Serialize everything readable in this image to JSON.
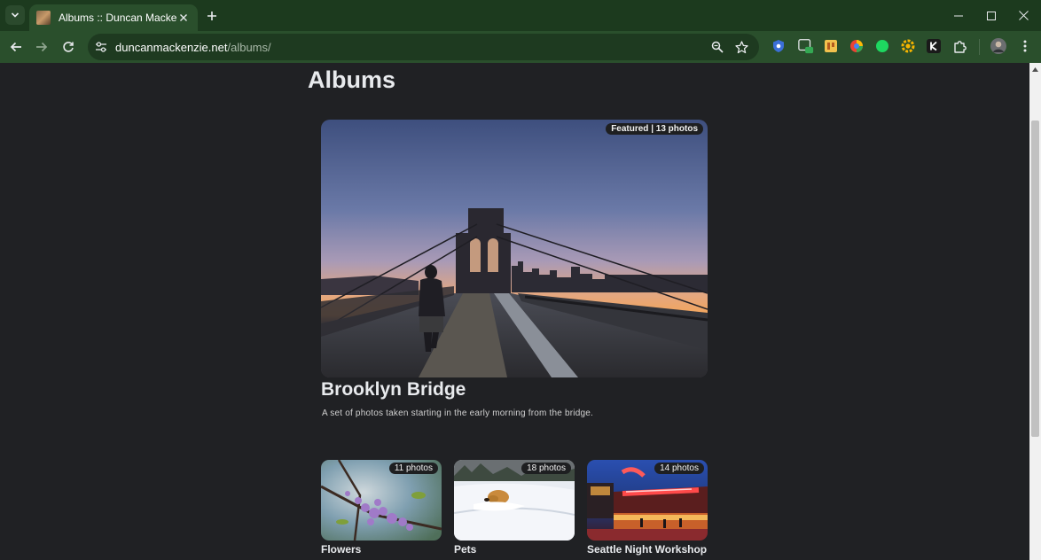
{
  "browser": {
    "tab": {
      "title": "Albums :: Duncan Mackenzie"
    },
    "url": {
      "host": "duncanmackenzie.net",
      "path": "/albums/"
    },
    "accent_color": "#2a4f2c"
  },
  "page": {
    "heading": "Albums",
    "featured_album": {
      "badge": "Featured | 13 photos",
      "title": "Brooklyn Bridge",
      "description": "A set of photos taken starting in the early morning from the bridge."
    },
    "albums": [
      {
        "name": "Flowers",
        "badge": "11 photos"
      },
      {
        "name": "Pets",
        "badge": "18 photos"
      },
      {
        "name": "Seattle Night Workshop",
        "badge": "14 photos"
      }
    ]
  },
  "icons": {
    "tab_search": "chevron-down-icon",
    "close_tab": "close-icon",
    "new_tab": "plus-icon",
    "back": "arrow-left-icon",
    "forward": "arrow-right-icon",
    "reload": "reload-icon",
    "site_info": "tune-icon",
    "zoom": "magnifier-icon",
    "bookmark": "star-icon",
    "extensions": "puzzle-icon",
    "menu": "kebab-icon"
  }
}
